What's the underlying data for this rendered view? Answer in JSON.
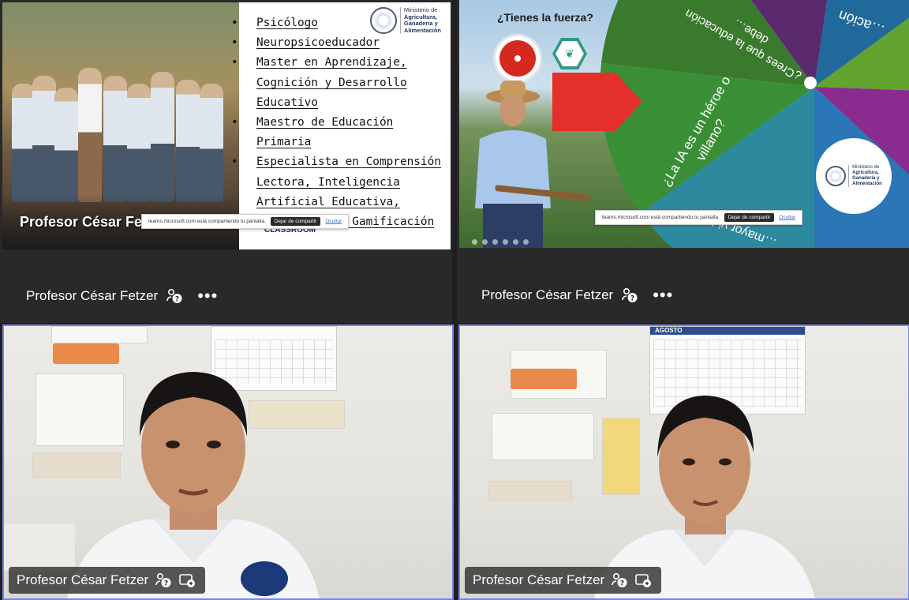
{
  "participant_name": "Profesor César Fetzer",
  "tiles": [
    {
      "id": "top-left",
      "kind": "screen-share",
      "name": "Profesor César Fetzer"
    },
    {
      "id": "top-right",
      "kind": "screen-share",
      "name": "Profesor César Fetzer"
    },
    {
      "id": "bottom-left",
      "kind": "video",
      "name": "Profesor César Fetzer",
      "speaking": true
    },
    {
      "id": "bottom-right",
      "kind": "video",
      "name": "Profesor César Fetzer",
      "speaking": true
    }
  ],
  "slide_left": {
    "photo_caption": "Profesor César Fetzer",
    "bullets": [
      "Psicólogo",
      "Neuropsicoeducador",
      "Master en Aprendizaje, Cognición y Desarrollo Educativo",
      "Maestro de Educación Primaria",
      "Especialista en Comprensión Lectora, Inteligencia Artificial Educativa, Aprendizaje y Gamificación"
    ],
    "logo_lines": [
      "Ministerio de",
      "Agricultura,",
      "Ganadería y",
      "Alimentación"
    ],
    "classroom_label": "CLASSROOM"
  },
  "slide_right": {
    "question": "¿Tienes la fuerza?",
    "wheel_texts": [
      "¿La IA es un héroe o villano?",
      "¿Crees que la educación debe…",
      "…ación",
      "…mayor vida…"
    ],
    "logo_lines": [
      "Ministerio de",
      "Agricultura,",
      "Ganadería y",
      "Alimentación"
    ]
  },
  "share_banner": {
    "message": "teams.microsoft.com está compartiendo tu pantalla.",
    "stop_label": "Dejar de compartir",
    "hide_label": "Ocultar"
  },
  "calendar_month": "AGOSTO",
  "icons": {
    "speaker_status": "person-help-icon",
    "more_options": "more-options-icon",
    "video_status": "video-share-icon"
  },
  "more_options_label": "•••",
  "colors": {
    "active_speaker_border": "#7b83eb",
    "tile_bg": "#292929",
    "stage_bg": "#1f1f1f"
  }
}
